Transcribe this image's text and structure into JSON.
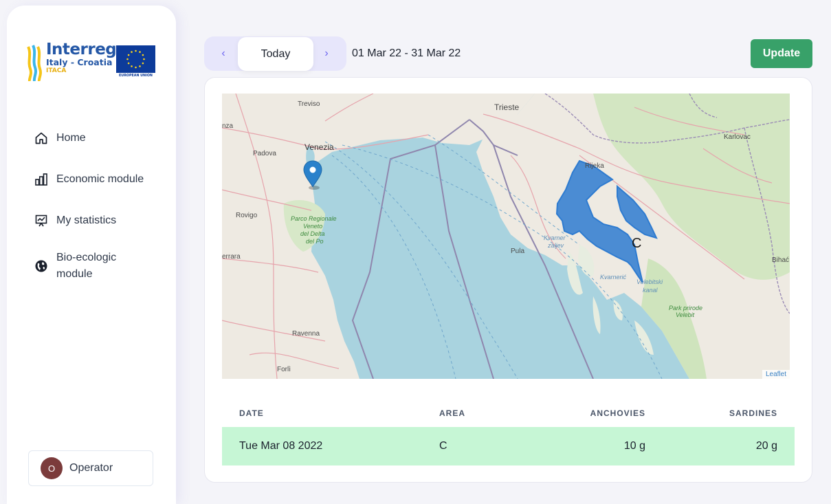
{
  "sidebar": {
    "logo": {
      "title": "Interreg",
      "subtitle": "Italy - Croatia",
      "program": "ITACA",
      "eu_label": "EUROPEAN UNION"
    },
    "items": [
      {
        "label": "Home",
        "icon": "home-icon"
      },
      {
        "label": "Economic module",
        "icon": "bar-chart-icon"
      },
      {
        "label": "My statistics",
        "icon": "presentation-chart-icon"
      },
      {
        "label": "Bio-ecologic module",
        "icon": "globe-icon"
      }
    ],
    "user": {
      "initial": "O",
      "name": "Operator"
    }
  },
  "toolbar": {
    "prev_label": "‹",
    "today_label": "Today",
    "next_label": "›",
    "date_range": "01 Mar 22 - 31 Mar 22",
    "update_label": "Update"
  },
  "map": {
    "labels": {
      "treviso": "Treviso",
      "trieste": "Trieste",
      "venezia": "Venezia",
      "padova": "Padova",
      "nza": "nza",
      "karlovac": "Karlovac",
      "rijeka": "Rijeka",
      "rovigo": "Rovigo",
      "parco1": "Parco Regionale",
      "parco2": "Veneto",
      "parco3": "del Delta",
      "parco4": "del Po",
      "errara": "errara",
      "pula": "Pula",
      "kvarner1": "Kvarner",
      "kvarner2": "zaljev",
      "kvarneric": "Kvarnerić",
      "velebit1": "Velebitski",
      "velebit2": "kanal",
      "park1": "Park prirode",
      "park2": "Velebit",
      "bihac": "Bihać",
      "ravenna": "Ravenna",
      "forli": "Forlì",
      "area": "C"
    },
    "attribution": "Leaflet",
    "colors": {
      "sea": "#a9d3df",
      "land": "#eeeae2",
      "area": "#2e7bd0",
      "marker": "#2a81cb"
    }
  },
  "table": {
    "headers": [
      "DATE",
      "AREA",
      "ANCHOVIES",
      "SARDINES"
    ],
    "rows": [
      {
        "date": "Tue Mar 08 2022",
        "area": "C",
        "anchovies": "10 g",
        "sardines": "20 g"
      }
    ],
    "row_color": "#c6f6d5"
  },
  "colors": {
    "accent": "#6b63f0",
    "update": "#38a169",
    "avatar": "#7b3b3b"
  }
}
